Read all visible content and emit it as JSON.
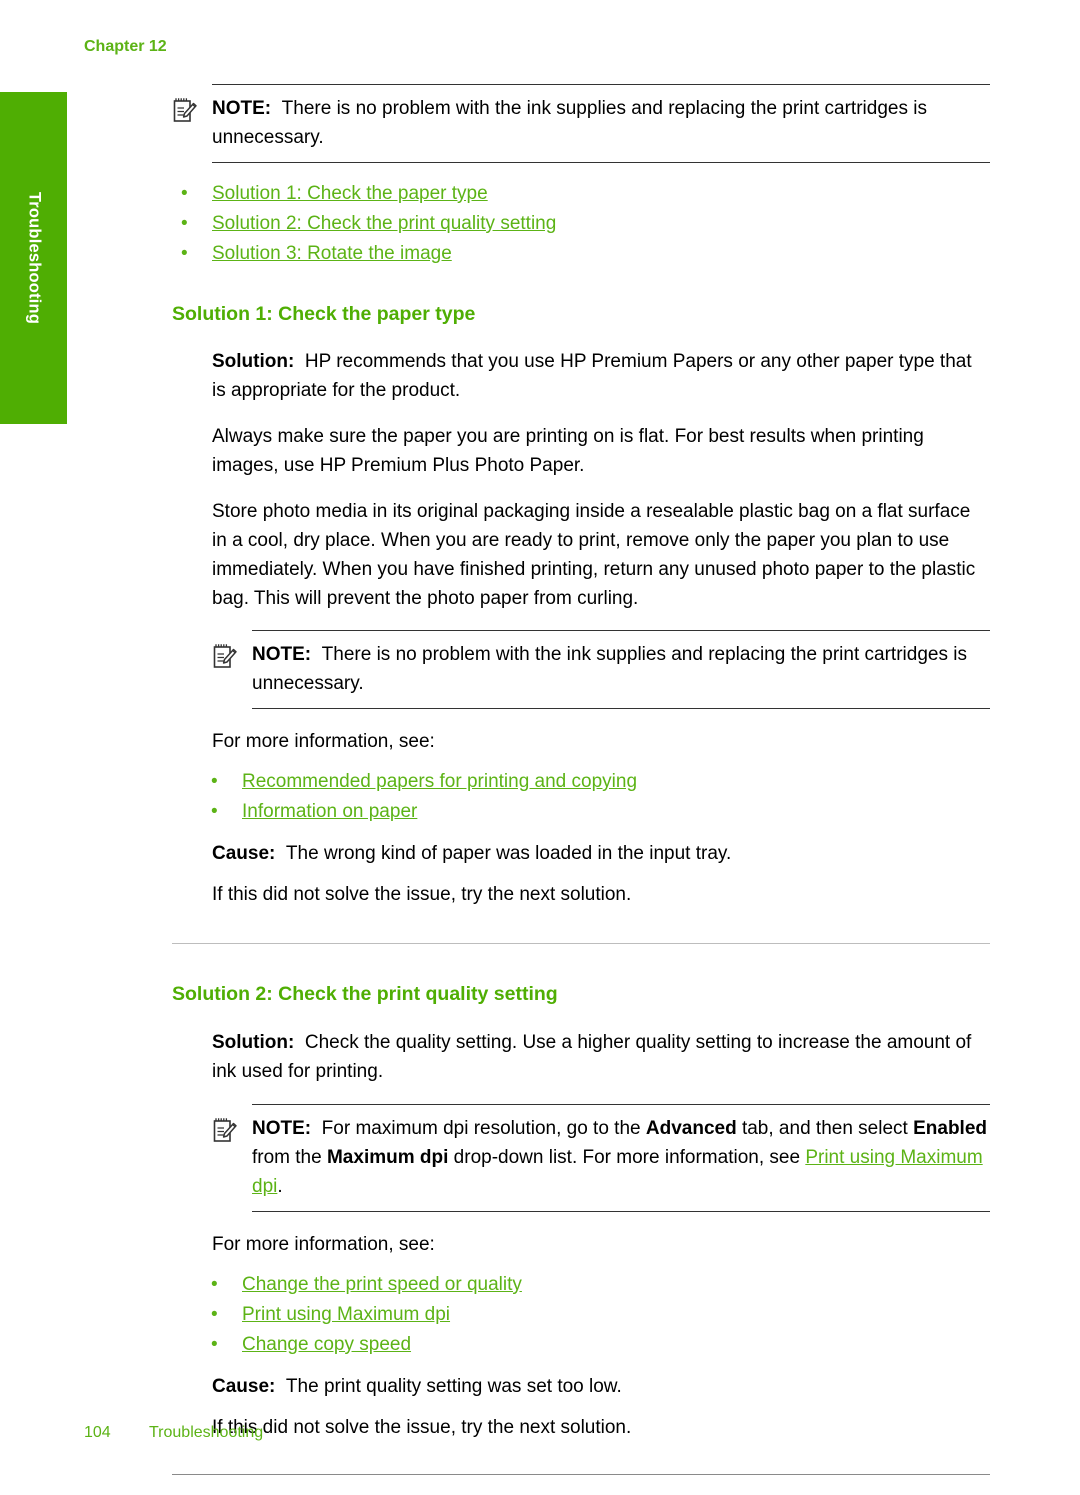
{
  "colors": {
    "tab_green": "#4fae03",
    "link_green": "#5cb316",
    "heading_green": "#4fae03",
    "rule_dark": "#333333",
    "rule_light": "#bdbdbd"
  },
  "side_tab": {
    "label": "Troubleshooting"
  },
  "header": {
    "chapter": "Chapter 12"
  },
  "footer": {
    "page_number": "104",
    "section": "Troubleshooting"
  },
  "note_top": {
    "icon": "note-pencil-icon",
    "label": "NOTE:",
    "text": "There is no problem with the ink supplies and replacing the print cartridges is unnecessary."
  },
  "solution_links": [
    {
      "label": "Solution 1: Check the paper type"
    },
    {
      "label": "Solution 2: Check the print quality setting"
    },
    {
      "label": "Solution 3: Rotate the image"
    }
  ],
  "solution1": {
    "heading": "Solution 1: Check the paper type",
    "solution_label": "Solution:",
    "solution_text": "HP recommends that you use HP Premium Papers or any other paper type that is appropriate for the product.",
    "paragraph2": "Always make sure the paper you are printing on is flat. For best results when printing images, use HP Premium Plus Photo Paper.",
    "paragraph3": "Store photo media in its original packaging inside a resealable plastic bag on a flat surface in a cool, dry place. When you are ready to print, remove only the paper you plan to use immediately. When you have finished printing, return any unused photo paper to the plastic bag. This will prevent the photo paper from curling.",
    "note": {
      "icon": "note-pencil-icon",
      "label": "NOTE:",
      "text": "There is no problem with the ink supplies and replacing the print cartridges is unnecessary."
    },
    "more_info_intro": "For more information, see:",
    "more_info_links": [
      {
        "label": "Recommended papers for printing and copying"
      },
      {
        "label": "Information on paper"
      }
    ],
    "cause_label": "Cause:",
    "cause_text": "The wrong kind of paper was loaded in the input tray.",
    "next_text": "If this did not solve the issue, try the next solution."
  },
  "solution2": {
    "heading": "Solution 2: Check the print quality setting",
    "solution_label": "Solution:",
    "solution_text": "Check the quality setting. Use a higher quality setting to increase the amount of ink used for printing.",
    "note": {
      "icon": "note-pencil-icon",
      "label": "NOTE:",
      "part1": "For maximum dpi resolution, go to the ",
      "bold1": "Advanced",
      "part2": " tab, and then select ",
      "bold2": "Enabled",
      "part3": " from the ",
      "bold3": "Maximum dpi",
      "part4": " drop-down list. For more information, see ",
      "link": "Print using Maximum dpi",
      "part5": "."
    },
    "more_info_intro": "For more information, see:",
    "more_info_links": [
      {
        "label": "Change the print speed or quality"
      },
      {
        "label": "Print using Maximum dpi"
      },
      {
        "label": "Change copy speed"
      }
    ],
    "cause_label": "Cause:",
    "cause_text": "The print quality setting was set too low.",
    "next_text": "If this did not solve the issue, try the next solution."
  }
}
